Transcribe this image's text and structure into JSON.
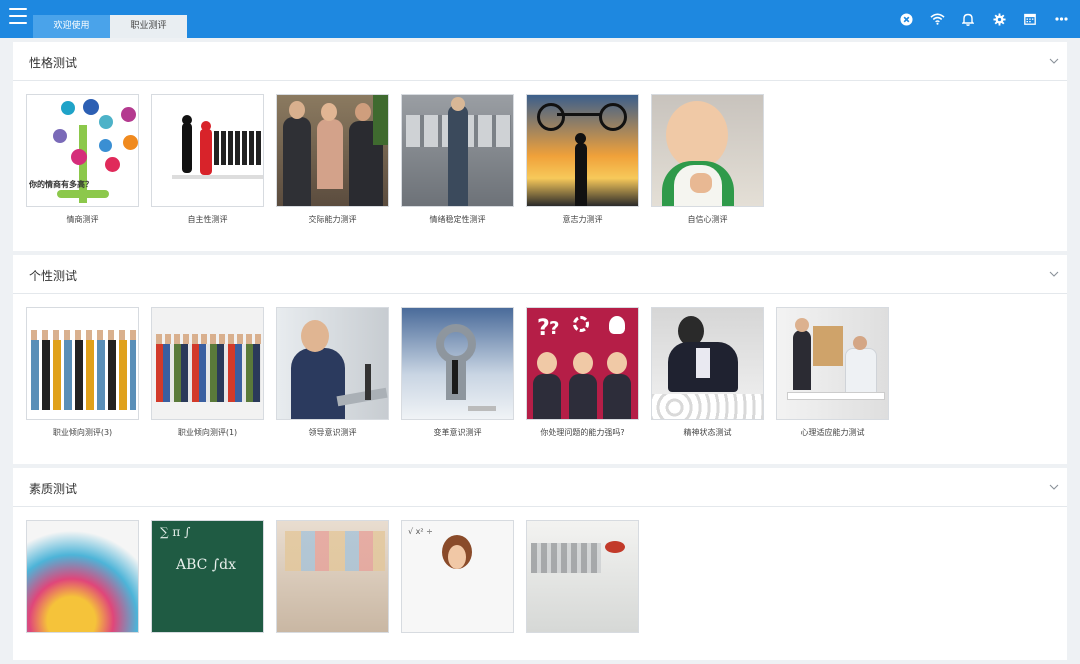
{
  "topbar": {
    "tabs": [
      {
        "label": "欢迎使用",
        "active": true
      },
      {
        "label": "职业测评",
        "active": false
      }
    ],
    "icons": [
      "close-circle-icon",
      "wifi-icon",
      "bell-icon",
      "gear-icon",
      "calendar-icon",
      "more-icon"
    ]
  },
  "sections": [
    {
      "title": "性格测试",
      "items": [
        {
          "label": "情商测评",
          "image_text": "你的情商有多高？"
        },
        {
          "label": "自主性测评"
        },
        {
          "label": "交际能力测评"
        },
        {
          "label": "情绪稳定性测评"
        },
        {
          "label": "意志力测评"
        },
        {
          "label": "自信心测评"
        }
      ]
    },
    {
      "title": "个性测试",
      "items": [
        {
          "label": "职业倾向测评(3)"
        },
        {
          "label": "职业倾向测评(1)"
        },
        {
          "label": "领导意识测评"
        },
        {
          "label": "变革意识测评"
        },
        {
          "label": "你处理问题的能力强吗?"
        },
        {
          "label": "精神状态测试"
        },
        {
          "label": "心理适应能力测试"
        }
      ]
    },
    {
      "title": "素质测试",
      "items": [
        {
          "label": ""
        },
        {
          "label": ""
        },
        {
          "label": ""
        },
        {
          "label": ""
        },
        {
          "label": ""
        }
      ]
    }
  ],
  "colors": {
    "accent": "#1e88e0",
    "tab_active": "#4aa3ea",
    "tab_inactive": "#e9eef2"
  }
}
